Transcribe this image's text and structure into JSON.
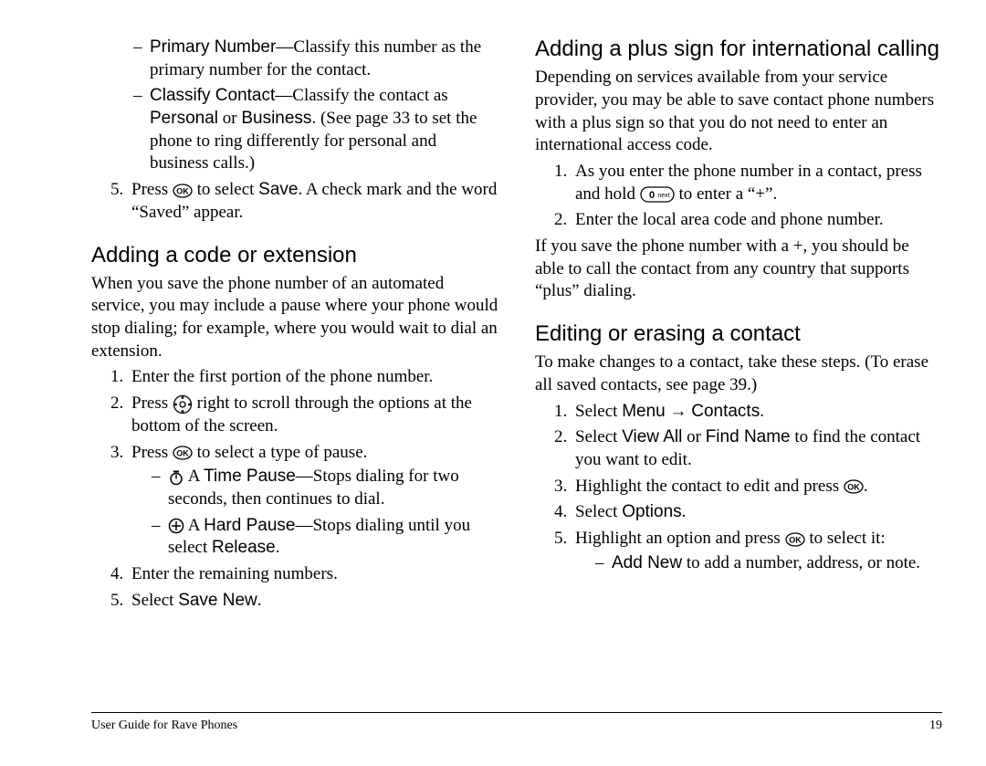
{
  "left": {
    "top_items": [
      {
        "t": "dash",
        "html": "<span class='sans'>Primary Number</span>—Classify this number as the primary number for the contact."
      },
      {
        "t": "dash",
        "html": "<span class='sans'>Classify Contact</span>—Classify the contact as <span class='sans'>Personal</span> or <span class='sans'>Business</span>. (See page 33 to set the phone to ring differently for personal and business calls.)"
      }
    ],
    "top_ol": {
      "start": 5,
      "items": [
        {
          "html": "Press {ok} to select <span class='sans'>Save</span>. A check mark and the word “Saved” appear."
        }
      ]
    },
    "h2_a": "Adding a code or extension",
    "p_a": "When you save the phone number of an automated service, you may include a pause where your phone would stop dialing; for example, where you would wait to dial an extension.",
    "ol_a": {
      "start": 1,
      "items": [
        {
          "html": "Enter the first portion of the phone number."
        },
        {
          "html": "Press {nav} right to scroll through the options at the bottom of the screen."
        },
        {
          "html": "Press {ok} to select a type of pause.",
          "sub": [
            {
              "html": "{timer} A <span class='sans'>Time Pause</span>—Stops dialing for two seconds, then continues to dial."
            },
            {
              "html": "{hard} A <span class='sans'>Hard Pause</span>—Stops dialing until you select <span class='sans'>Release</span>."
            }
          ]
        },
        {
          "html": "Enter the remaining numbers."
        },
        {
          "html": "Select <span class='sans'>Save New</span>."
        }
      ]
    }
  },
  "right": {
    "h2_a": "Adding a plus sign for international calling",
    "p_a": "Depending on services available from your service provider, you may be able to save contact phone numbers with a plus sign so that you do not need to enter an international access code.",
    "ol_a": {
      "start": 1,
      "items": [
        {
          "html": "As you enter the phone number in a contact, press and hold {zero} to enter a “+”."
        },
        {
          "html": "Enter the local area code and phone number."
        }
      ]
    },
    "p_b": "If you save the phone number with a +, you should be able to call the contact from any country that supports “plus” dialing.",
    "h2_b": "Editing or erasing a contact",
    "p_c": "To make changes to a contact, take these steps. (To erase all saved contacts, see page 39.)",
    "ol_b": {
      "start": 1,
      "items": [
        {
          "html": "Select <span class='sans'>Menu</span> → <span class='sans'>Contacts</span>."
        },
        {
          "html": "Select <span class='sans'>View All</span> or <span class='sans'>Find Name</span> to find the contact you want to edit."
        },
        {
          "html": "Highlight the contact to edit and press {ok}."
        },
        {
          "html": "Select <span class='sans'>Options</span>."
        },
        {
          "html": "Highlight an option and press {ok} to select it:",
          "sub": [
            {
              "html": "<span class='sans'>Add New</span> to add a number, address, or note."
            }
          ]
        }
      ]
    }
  },
  "footer": {
    "left": "User Guide for Rave Phones",
    "right": "19"
  }
}
